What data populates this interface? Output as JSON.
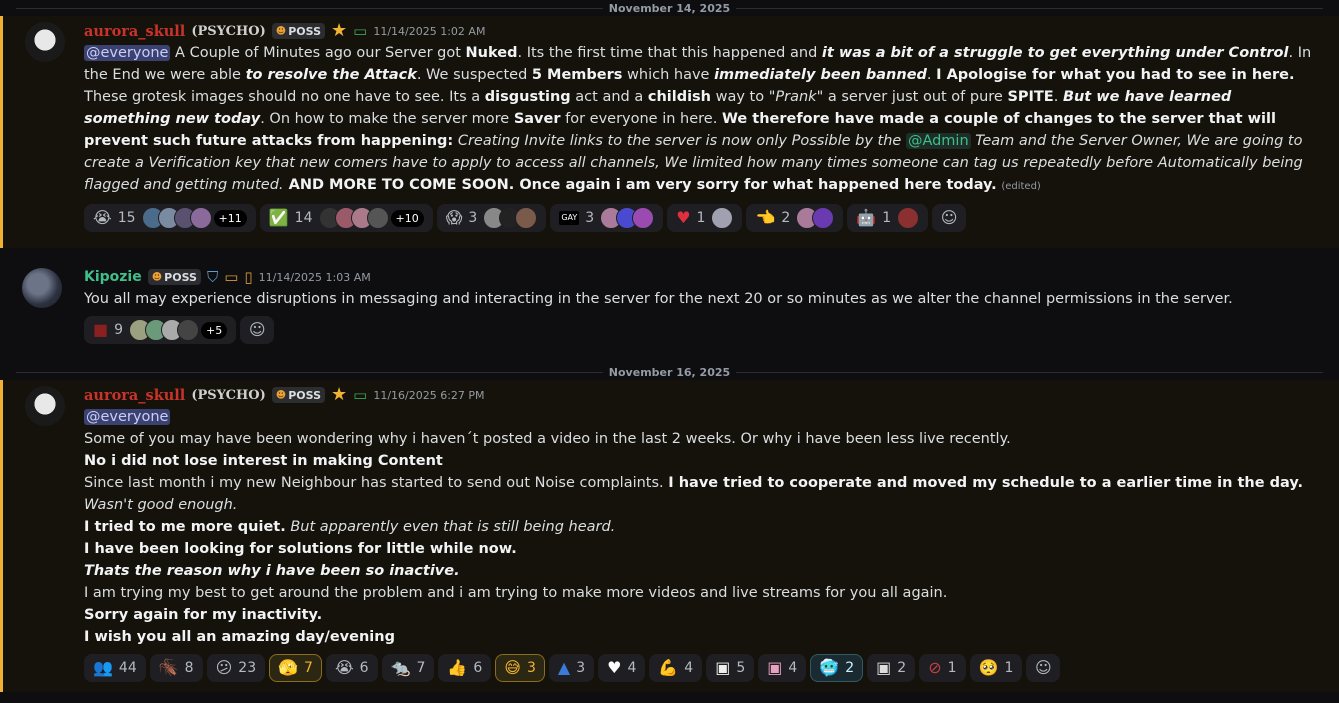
{
  "dividers": [
    "November 14, 2025",
    "November 16, 2025"
  ],
  "messages": [
    {
      "author": "aurora_skull",
      "tag": "(PSYCHO)",
      "badge": "POSS",
      "time": "11/14/2025 1:02 AM",
      "body": {
        "mention": "@everyone",
        "t1": " A Couple of Minutes ago our Server got ",
        "b1": "Nuked",
        "t2": ". Its the first time that this happened and ",
        "bi1": "it was a bit of a struggle to get everything under Control",
        "t3": ". In the End we were able ",
        "bi2": "to resolve the Attack",
        "t4": ". We suspected ",
        "b2": "5 Members",
        "t5": " which have ",
        "bi3": "immediately been banned",
        "t6": ". ",
        "b3": "I Apologise for what you had to see in here.",
        "t7": " These grotesk images should no one have to see. Its a ",
        "b4": "disgusting",
        "t8": " act and a ",
        "b5": "childish",
        "t9": " way to \"",
        "i1": "Prank",
        "t10": "\" a server just out of pure ",
        "b6": "SPITE",
        "t11": ". ",
        "bi4": "But we have learned something new today",
        "t12": ". On how to make the server more ",
        "b7": "Saver",
        "t13": " for everyone in here. ",
        "b8": "We therefore have made a couple of changes to the server that will prevent such future attacks from happening:",
        "i2": " Creating Invite links to the server is now only Possible by the ",
        "role": "@Admin",
        "i3": " Team and the Server Owner, We are going to create a Verification key that new comers have to apply to access all channels, We limited how many times someone can tag us repeatedly before Automatically being flagged and getting muted.",
        "b9": " AND MORE TO COME SOON. Once again i am very sorry for what happened here today.",
        "edited": "(edited)"
      },
      "reactions": [
        {
          "emoji": "crying-face",
          "count": "15",
          "more": "+11"
        },
        {
          "emoji": "check-mark",
          "count": "14",
          "more": "+10"
        },
        {
          "emoji": "screaming-face",
          "count": "3"
        },
        {
          "emoji": "gay-badge",
          "label": "GAY",
          "count": "3"
        },
        {
          "emoji": "red-heart",
          "count": "1"
        },
        {
          "emoji": "pointing-hand",
          "count": "2"
        },
        {
          "emoji": "robot-face",
          "count": "1"
        }
      ]
    },
    {
      "author": "Kipozie",
      "badge": "POSS",
      "time": "11/14/2025 1:03 AM",
      "body": "You all may experience disruptions in messaging and interacting in the server for the next 20 or so minutes as we alter the channel permissions in the server.",
      "reactions": [
        {
          "emoji": "red-square",
          "count": "9",
          "more": "+5"
        }
      ]
    },
    {
      "author": "aurora_skull",
      "tag": "(PSYCHO)",
      "badge": "POSS",
      "time": "11/16/2025 6:27 PM",
      "lines": [
        "@everyone",
        "Some of you may have been wondering why i haven´t posted a video in the last 2 weeks. Or why i have been less live recently.",
        "No i did not lose interest in making Content",
        "Since last month i my new Neighbour has started to send out Noise complaints. ",
        "I have tried to cooperate and moved my schedule to a earlier time in the day.",
        "Wasn't good enough.",
        "I tried to me more quiet.",
        " But apparently even that is still being heard.",
        "I have been looking for solutions for little while now.",
        "Thats the reason why i have been so inactive.",
        "I am trying my best to get around the problem and i am trying to make more videos and live streams for you all again.",
        "Sorry again for my inactivity.",
        "I wish you all an amazing day/evening"
      ],
      "reactions": [
        {
          "emoji": "people-silhouette",
          "count": "44"
        },
        {
          "emoji": "cockroach",
          "count": "8"
        },
        {
          "emoji": "confused-face",
          "count": "23"
        },
        {
          "emoji": "hands-face",
          "count": "7"
        },
        {
          "emoji": "crying-face",
          "count": "6"
        },
        {
          "emoji": "rat",
          "count": "7"
        },
        {
          "emoji": "thumbs-up",
          "count": "6"
        },
        {
          "emoji": "sweat-smile-face",
          "count": "3"
        },
        {
          "emoji": "blue-figure",
          "count": "3"
        },
        {
          "emoji": "white-heart",
          "count": "4"
        },
        {
          "emoji": "flexed-arm",
          "count": "4"
        },
        {
          "emoji": "white-sticker",
          "count": "5"
        },
        {
          "emoji": "pink-sticker",
          "count": "4"
        },
        {
          "emoji": "cold-face",
          "count": "2"
        },
        {
          "emoji": "white-sticker-2",
          "count": "2"
        },
        {
          "emoji": "no-entry-sticker",
          "count": "1"
        },
        {
          "emoji": "pleading-face",
          "count": "1"
        }
      ]
    }
  ],
  "colors": {
    "mention_border": "#f0b232",
    "background": "#0e0e10",
    "author_red": "#c9332a",
    "author_green": "#3fbf8a"
  }
}
